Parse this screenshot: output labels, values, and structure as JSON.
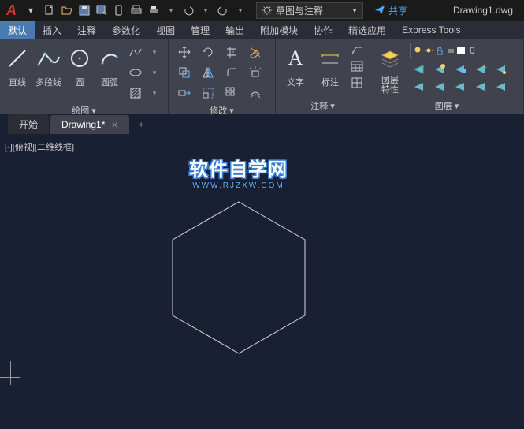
{
  "titlebar": {
    "workspace": "草图与注释",
    "share": "共享",
    "filename": "Drawing1.dwg"
  },
  "menu": {
    "items": [
      "默认",
      "插入",
      "注释",
      "参数化",
      "视图",
      "管理",
      "输出",
      "附加模块",
      "协作",
      "精选应用",
      "Express Tools"
    ],
    "active_index": 0
  },
  "ribbon": {
    "draw": {
      "line": "直线",
      "polyline": "多段线",
      "circle": "圆",
      "arc": "圆弧",
      "title": "绘图 ▾"
    },
    "modify": {
      "title": "修改 ▾"
    },
    "annotate": {
      "text": "文字",
      "dim": "标注",
      "title": "注释 ▾"
    },
    "layer": {
      "props": "图层\n特性",
      "current": "0",
      "title": "图层 ▾"
    }
  },
  "tabs": {
    "start": "开始",
    "drawing": "Drawing1*"
  },
  "canvas": {
    "viewport_label": "[-][俯视][二维线框]"
  },
  "watermark": {
    "main": "软件自学网",
    "sub": "WWW.RJZXW.COM"
  }
}
